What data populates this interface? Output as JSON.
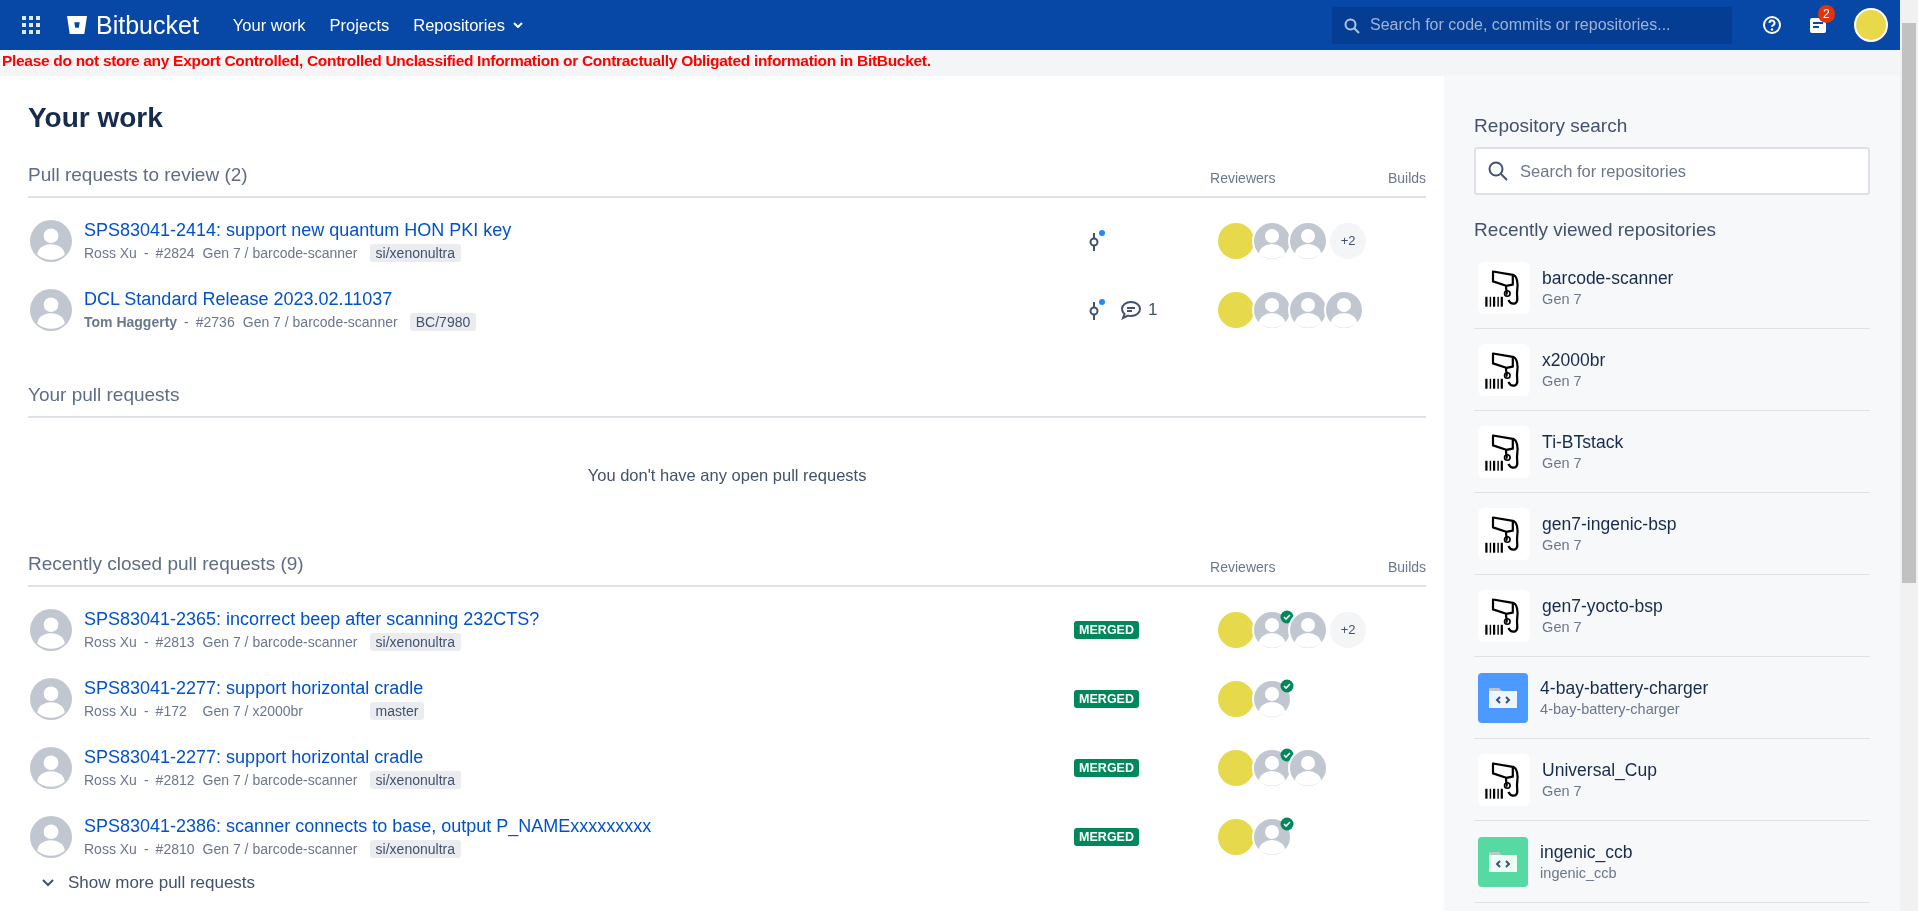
{
  "topbar": {
    "product": "Bitbucket",
    "nav": [
      {
        "label": "Your work",
        "dropdown": false
      },
      {
        "label": "Projects",
        "dropdown": false
      },
      {
        "label": "Repositories",
        "dropdown": true
      }
    ],
    "search": {
      "placeholder": "Search for code, commits or repositories..."
    },
    "notifications": "2"
  },
  "banner": "Please do not store any Export Controlled, Controlled Unclassified Information or Contractually Obligated information in BitBucket.",
  "page_title": "Your work",
  "sections": [
    {
      "title": "Pull requests to review (2)",
      "columns": [
        "Reviewers",
        "Builds"
      ],
      "rows": [
        {
          "title": "SPS83041-2414: support new quantum HON PKI key",
          "author": "Ross Xu",
          "author_bold": false,
          "separator": "-",
          "number": "#2824",
          "repo": "Gen 7 / barcode-scanner",
          "branch": "si/xenonultra",
          "new_commits": true,
          "reviewers": [
            {
              "kind": "photo",
              "approved": false
            },
            {
              "kind": "default",
              "approved": false
            },
            {
              "kind": "default",
              "approved": false
            }
          ],
          "more_reviewers": "+2"
        },
        {
          "title": "DCL Standard Release 2023.02.11037",
          "author": "Tom Haggerty",
          "author_bold": true,
          "separator": "-",
          "number": "#2736",
          "repo": "Gen 7 / barcode-scanner",
          "branch": "BC/7980",
          "new_commits": true,
          "comments": "1",
          "reviewers": [
            {
              "kind": "photo",
              "approved": false
            },
            {
              "kind": "default",
              "approved": false
            },
            {
              "kind": "default",
              "approved": false
            },
            {
              "kind": "default",
              "approved": false
            }
          ]
        }
      ]
    },
    {
      "title": "Your pull requests",
      "empty_message": "You don't have any open pull requests"
    },
    {
      "title": "Recently closed pull requests (9)",
      "columns": [
        "Reviewers",
        "Builds"
      ],
      "rows": [
        {
          "title": "SPS83041-2365: incorrect beep after scanning 232CTS?",
          "author": "Ross Xu",
          "author_bold": false,
          "separator": "-",
          "number": "#2813",
          "repo": "Gen 7 / barcode-scanner",
          "branch": "si/xenonultra",
          "status": "MERGED",
          "new_commits": false,
          "reviewers": [
            {
              "kind": "photo",
              "approved": false
            },
            {
              "kind": "default",
              "approved": true
            },
            {
              "kind": "default",
              "approved": false
            }
          ],
          "more_reviewers": "+2"
        },
        {
          "title": "SPS83041-2277: support horizontal cradle",
          "author": "Ross Xu",
          "author_bold": false,
          "separator": "-",
          "number": "#172",
          "repo": "Gen 7 / x2000br",
          "branch": "master",
          "status": "MERGED",
          "new_commits": false,
          "reviewers": [
            {
              "kind": "photo",
              "approved": false
            },
            {
              "kind": "default",
              "approved": true
            }
          ]
        },
        {
          "title": "SPS83041-2277: support horizontal cradle",
          "author": "Ross Xu",
          "author_bold": false,
          "separator": "-",
          "number": "#2812",
          "repo": "Gen 7 / barcode-scanner",
          "branch": "si/xenonultra",
          "status": "MERGED",
          "new_commits": false,
          "reviewers": [
            {
              "kind": "photo",
              "approved": false
            },
            {
              "kind": "default",
              "approved": true
            },
            {
              "kind": "default",
              "approved": false
            }
          ]
        },
        {
          "title": "SPS83041-2386: scanner connects to base, output P_NAMExxxxxxxxx",
          "author": "Ross Xu",
          "author_bold": false,
          "separator": "-",
          "number": "#2810",
          "repo": "Gen 7 / barcode-scanner",
          "branch": "si/xenonultra",
          "status": "MERGED",
          "new_commits": false,
          "reviewers": [
            {
              "kind": "photo",
              "approved": false
            },
            {
              "kind": "default",
              "approved": true
            }
          ]
        }
      ]
    }
  ],
  "show_more": "Show more pull requests",
  "sidebar": {
    "search_title": "Repository search",
    "search": {
      "placeholder": "Search for repositories"
    },
    "recent_title": "Recently viewed repositories",
    "repositories": [
      {
        "name": "barcode-scanner",
        "project": "Gen 7",
        "kind": "scanner"
      },
      {
        "name": "x2000br",
        "project": "Gen 7",
        "kind": "scanner"
      },
      {
        "name": "Ti-BTstack",
        "project": "Gen 7",
        "kind": "scanner"
      },
      {
        "name": "gen7-ingenic-bsp",
        "project": "Gen 7",
        "kind": "scanner"
      },
      {
        "name": "gen7-yocto-bsp",
        "project": "Gen 7",
        "kind": "scanner"
      },
      {
        "name": "4-bay-battery-charger",
        "project": "4-bay-battery-charger",
        "kind": "folder",
        "color": "#4c9aff"
      },
      {
        "name": "Universal_Cup",
        "project": "Gen 7",
        "kind": "scanner"
      },
      {
        "name": "ingenic_ccb",
        "project": "ingenic_ccb",
        "kind": "folder",
        "color": "#57d9a3"
      }
    ]
  }
}
